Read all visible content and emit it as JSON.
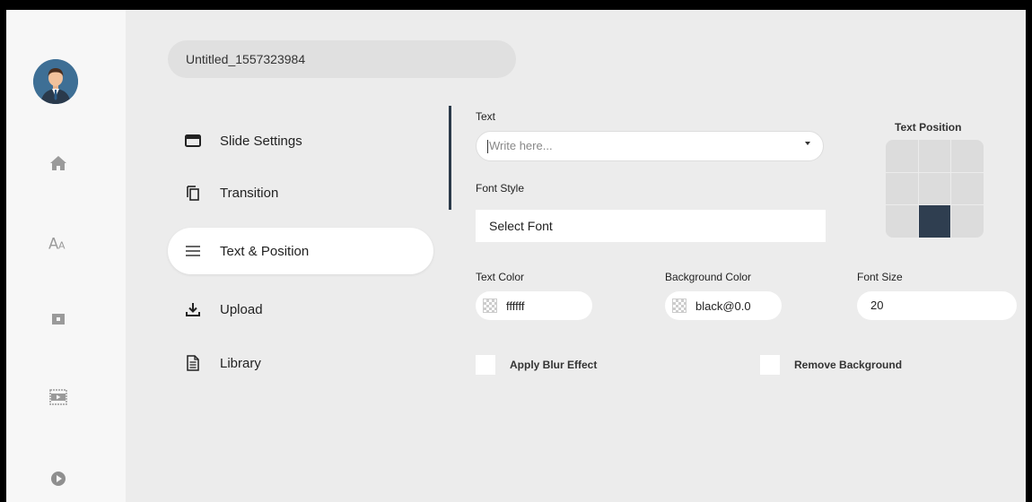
{
  "project": {
    "title": "Untitled_1557323984"
  },
  "sidebar": {
    "icons": [
      {
        "name": "home-icon"
      },
      {
        "name": "font-icon"
      },
      {
        "name": "media-icon"
      },
      {
        "name": "film-icon"
      },
      {
        "name": "play-icon"
      }
    ]
  },
  "menu": {
    "items": [
      {
        "label": "Slide Settings",
        "icon": "slide-settings-icon"
      },
      {
        "label": "Transition",
        "icon": "copy-icon"
      },
      {
        "label": "Text & Position",
        "icon": "lines-icon",
        "active": true
      },
      {
        "label": "Upload",
        "icon": "upload-icon"
      },
      {
        "label": "Library",
        "icon": "document-icon"
      }
    ]
  },
  "form": {
    "text_label": "Text",
    "text_placeholder": "Write here...",
    "font_style_label": "Font Style",
    "font_select_value": "Select Font",
    "text_position_label": "Text Position",
    "text_position_selected": "bottom-center",
    "text_color_label": "Text Color",
    "text_color_value": "ffffff",
    "bg_color_label": "Background Color",
    "bg_color_value": "black@0.0",
    "font_size_label": "Font Size",
    "font_size_value": "20",
    "blur_label": "Apply Blur Effect",
    "remove_bg_label": "Remove Background"
  },
  "colors": {
    "accent_dark": "#2f3e50",
    "background": "#ececec",
    "avatar_bg": "#3e6f95"
  }
}
